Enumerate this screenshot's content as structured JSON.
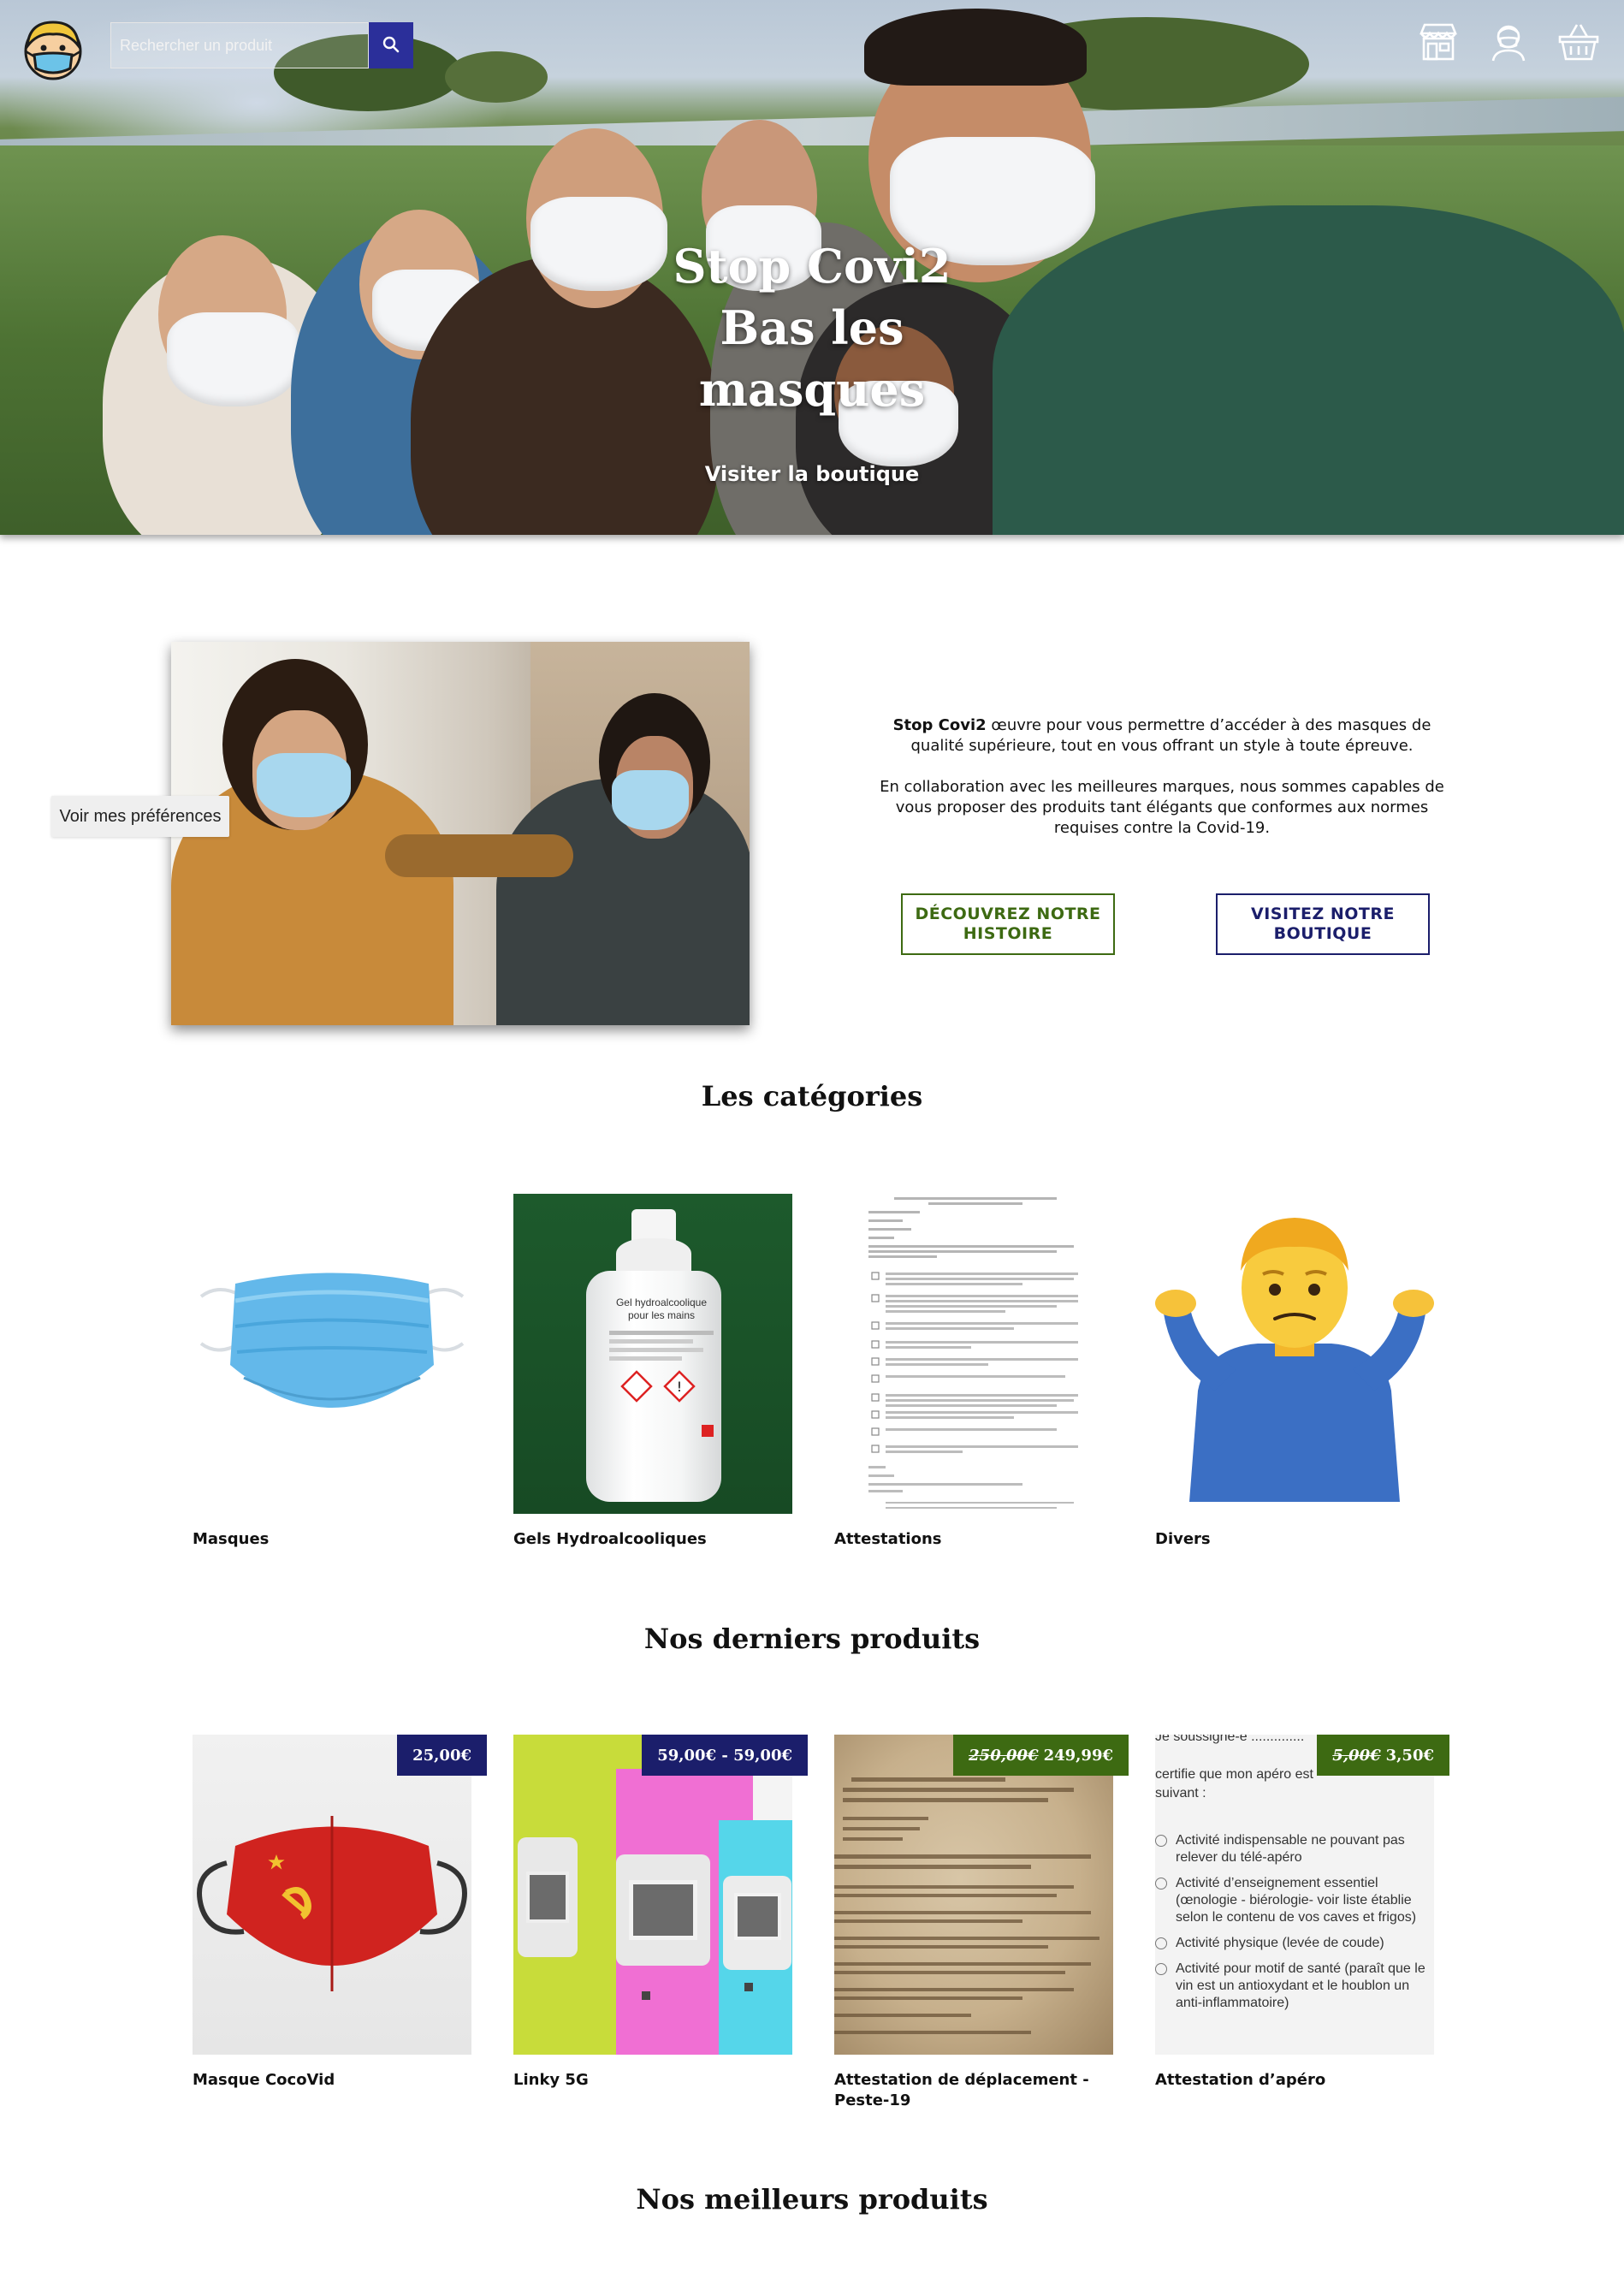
{
  "header": {
    "search": {
      "placeholder": "Rechercher un produit"
    }
  },
  "hero": {
    "title_lines": [
      "Stop Covi2",
      "Bas les",
      "masques"
    ],
    "cta": "Visiter la boutique"
  },
  "about": {
    "brand": "Stop Covi2",
    "paragraph1": " œuvre pour vous permettre d’accéder à des masques de qualité supérieure, tout en vous offrant un style à toute épreuve.",
    "paragraph2": "En collaboration avec les meilleures marques, nous sommes capables de vous proposer des produits tant élégants que conformes aux normes requises contre la Covid-19.",
    "button_story": "DÉCOUVREZ NOTRE HISTOIRE",
    "button_shop": "VISITEZ NOTRE BOUTIQUE",
    "preferences_button": "Voir mes préférences"
  },
  "categories": {
    "title": "Les catégories",
    "items": [
      {
        "label": "Masques"
      },
      {
        "label": "Gels Hydroalcooliques"
      },
      {
        "label": "Attestations"
      },
      {
        "label": "Divers"
      }
    ]
  },
  "latest": {
    "title": "Nos derniers produits",
    "items": [
      {
        "label": "Masque CocoVid",
        "price": "25,00€",
        "old_price": "",
        "tag_color": "#1b1e6b"
      },
      {
        "label": "Linky 5G",
        "price": "59,00€ - 59,00€",
        "old_price": "",
        "tag_color": "#1b1e6b"
      },
      {
        "label": "Attestation de déplacement - Peste-19",
        "price": "249,99€",
        "old_price": "250,00€",
        "tag_color": "#3d6a12"
      },
      {
        "label": "Attestation d’apéro",
        "price": "3,50€",
        "old_price": "5,00€",
        "tag_color": "#3d6a12"
      }
    ]
  },
  "best": {
    "title": "Nos meilleurs produits"
  },
  "gel_label": {
    "line1": "Gel hydroalcoolique",
    "line2": "pour les mains"
  },
  "apero_form": {
    "line1": "Je soussigné-e ..............",
    "line2": "certifie que mon apéro est",
    "line3": "suivant :",
    "options": [
      "Activité indispensable ne pouvant pas relever du télé-apéro",
      "Activité d’enseignement essentiel (œnologie - biérologie- voir liste établie selon le contenu de vos caves et frigos)",
      "Activité physique (levée de coude)",
      "Activité pour motif de santé (paraît que le vin est un antioxydant et le houblon un anti-inflammatoire)"
    ]
  }
}
